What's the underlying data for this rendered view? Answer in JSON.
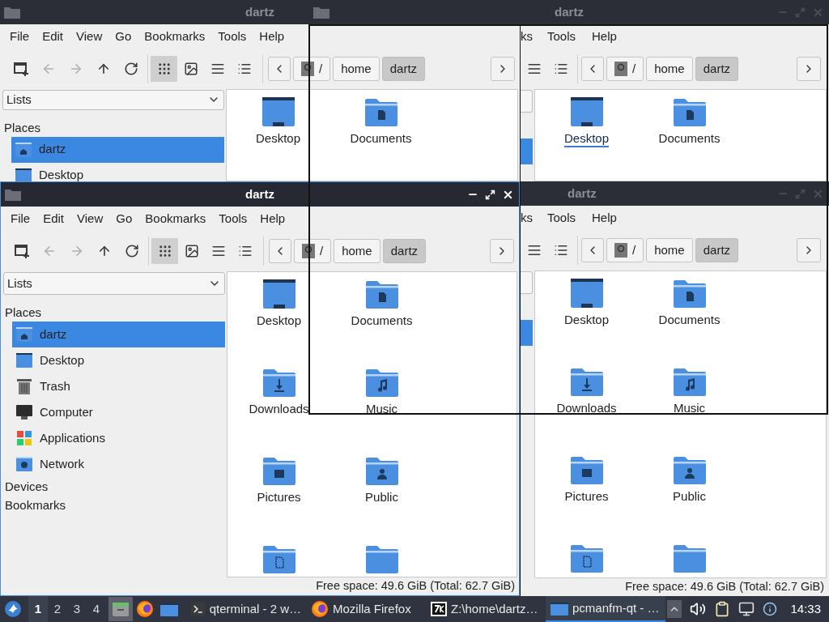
{
  "windows": [
    {
      "kind": "left",
      "title": "dartz",
      "active": false,
      "title_buttons": false,
      "menu": [
        "File",
        "Edit",
        "View",
        "Go",
        "Bookmarks",
        "Tools",
        "Help"
      ],
      "nav": [
        {
          "kind": "new",
          "disabled": false
        },
        {
          "kind": "back",
          "disabled": true
        },
        {
          "kind": "forward",
          "disabled": true
        },
        {
          "kind": "up",
          "disabled": false
        },
        {
          "kind": "reload",
          "disabled": false
        }
      ],
      "view_modes": [
        {
          "kind": "icons",
          "selected": true
        },
        {
          "kind": "thumbnails",
          "selected": false
        },
        {
          "kind": "compact",
          "selected": false
        },
        {
          "kind": "detailed",
          "selected": false
        }
      ],
      "path": [
        {
          "label": "/",
          "kind": "root",
          "selected": false
        },
        {
          "label": "home",
          "kind": "dir",
          "selected": false
        },
        {
          "label": "dartz",
          "kind": "dir",
          "selected": true
        }
      ],
      "sidebar": {
        "dropdown": "Lists",
        "sections": [
          {
            "label": "Places",
            "items": [
              {
                "label": "dartz",
                "kind": "home",
                "selected": true
              },
              {
                "label": "Desktop",
                "kind": "desktop",
                "selected": false
              }
            ]
          }
        ]
      },
      "files": [
        {
          "name": "Desktop",
          "kind": "desktop",
          "hover": false
        },
        {
          "name": "Documents",
          "kind": "documents",
          "hover": false
        }
      ]
    },
    {
      "kind": "right",
      "title": "dartz",
      "active": false,
      "title_buttons": true,
      "menu": [
        "ks",
        "Tools",
        "Help"
      ],
      "view_modes": [
        {
          "kind": "compact",
          "selected": false
        },
        {
          "kind": "detailed",
          "selected": false
        }
      ],
      "path": [
        {
          "label": "/",
          "kind": "root",
          "selected": false
        },
        {
          "label": "home",
          "kind": "dir",
          "selected": false
        },
        {
          "label": "dartz",
          "kind": "dir",
          "selected": true
        }
      ],
      "sidebar": {
        "items": [
          {
            "selected": true
          }
        ]
      },
      "files": [
        {
          "name": "Desktop",
          "kind": "desktop",
          "hover": true
        },
        {
          "name": "Documents",
          "kind": "documents",
          "hover": false
        }
      ]
    },
    {
      "kind": "left",
      "title": "dartz",
      "active": true,
      "title_buttons": true,
      "menu": [
        "File",
        "Edit",
        "View",
        "Go",
        "Bookmarks",
        "Tools",
        "Help"
      ],
      "nav": [
        {
          "kind": "new",
          "disabled": false
        },
        {
          "kind": "back",
          "disabled": true
        },
        {
          "kind": "forward",
          "disabled": true
        },
        {
          "kind": "up",
          "disabled": false
        },
        {
          "kind": "reload",
          "disabled": false
        }
      ],
      "view_modes": [
        {
          "kind": "icons",
          "selected": true
        },
        {
          "kind": "thumbnails",
          "selected": false
        },
        {
          "kind": "compact",
          "selected": false
        },
        {
          "kind": "detailed",
          "selected": false
        }
      ],
      "path": [
        {
          "label": "/",
          "kind": "root",
          "selected": false
        },
        {
          "label": "home",
          "kind": "dir",
          "selected": false
        },
        {
          "label": "dartz",
          "kind": "dir",
          "selected": true
        }
      ],
      "sidebar": {
        "dropdown": "Lists",
        "sections": [
          {
            "label": "Places",
            "items": [
              {
                "label": "dartz",
                "kind": "home",
                "selected": true
              },
              {
                "label": "Desktop",
                "kind": "desktop",
                "selected": false
              },
              {
                "label": "Trash",
                "kind": "trash",
                "selected": false
              },
              {
                "label": "Computer",
                "kind": "computer",
                "selected": false
              },
              {
                "label": "Applications",
                "kind": "applications",
                "selected": false
              },
              {
                "label": "Network",
                "kind": "network",
                "selected": false
              }
            ]
          },
          {
            "label": "Devices"
          },
          {
            "label": "Bookmarks"
          }
        ]
      },
      "files": [
        {
          "name": "Desktop",
          "kind": "desktop",
          "hover": false
        },
        {
          "name": "Documents",
          "kind": "documents",
          "hover": false
        },
        {
          "name": "Downloads",
          "kind": "downloads",
          "hover": false
        },
        {
          "name": "Music",
          "kind": "music",
          "hover": false
        },
        {
          "name": "Pictures",
          "kind": "pictures",
          "hover": false
        },
        {
          "name": "Public",
          "kind": "public",
          "hover": false
        },
        {
          "kind": "templates"
        },
        {
          "kind": "plain"
        }
      ],
      "status": "Free space: 49.6 GiB (Total: 62.7 GiB)"
    },
    {
      "kind": "right",
      "title": "dartz",
      "active": false,
      "title_buttons": true,
      "menu": [
        "ks",
        "Tools",
        "Help"
      ],
      "view_modes": [
        {
          "kind": "compact",
          "selected": false
        },
        {
          "kind": "detailed",
          "selected": false
        }
      ],
      "path": [
        {
          "label": "/",
          "kind": "root",
          "selected": false
        },
        {
          "label": "home",
          "kind": "dir",
          "selected": false
        },
        {
          "label": "dartz",
          "kind": "dir",
          "selected": true
        }
      ],
      "sidebar": {
        "items": [
          {
            "selected": true
          }
        ]
      },
      "files": [
        {
          "name": "Desktop",
          "kind": "desktop",
          "hover": false
        },
        {
          "name": "Documents",
          "kind": "documents",
          "hover": false
        },
        {
          "name": "Downloads",
          "kind": "downloads",
          "hover": false
        },
        {
          "name": "Music",
          "kind": "music",
          "hover": false
        },
        {
          "name": "Pictures",
          "kind": "pictures",
          "hover": false
        },
        {
          "name": "Public",
          "kind": "public",
          "hover": false
        },
        {
          "kind": "templates"
        },
        {
          "kind": "plain"
        }
      ],
      "status": "Free space: 49.6 GiB (Total: 62.7 GiB)"
    }
  ],
  "taskbar": {
    "workspaces": [
      {
        "label": "1",
        "selected": true
      },
      {
        "label": "2",
        "selected": false
      },
      {
        "label": "3",
        "selected": false
      },
      {
        "label": "4",
        "selected": false
      }
    ],
    "launchers": [
      {
        "kind": "files",
        "selected": true
      },
      {
        "kind": "firefox",
        "selected": false
      },
      {
        "kind": "folder",
        "selected": false
      }
    ],
    "tasks": [
      {
        "label": "qterminal - 2 w…",
        "kind": "terminal",
        "selected": false
      },
      {
        "label": "Mozilla Firefox",
        "kind": "firefox",
        "selected": false
      },
      {
        "label": "Z:\\home\\dartz…",
        "kind": "archive",
        "selected": false
      },
      {
        "label": "pcmanfm-qt - …",
        "kind": "folder",
        "selected": true
      }
    ],
    "clock": "14:33"
  }
}
